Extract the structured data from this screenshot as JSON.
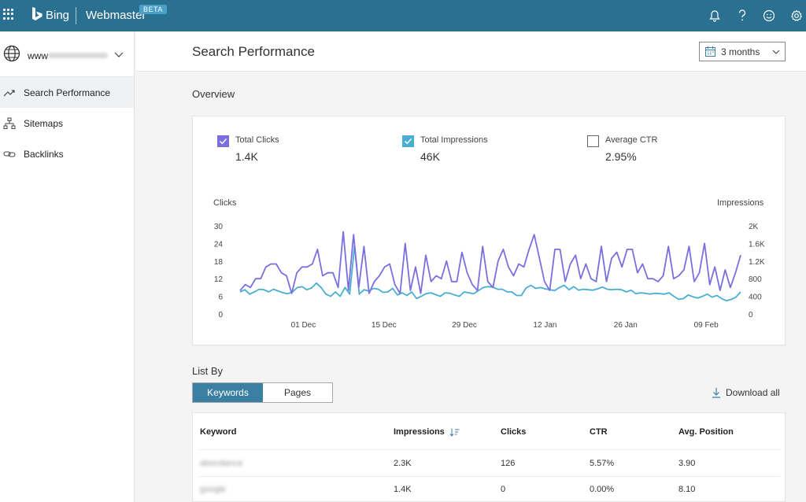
{
  "topbar": {
    "brand": "Bing",
    "product": "Webmaster",
    "badge": "BETA",
    "icons": [
      "apps-grid-icon",
      "bing-logo-icon",
      "bell-icon",
      "help-icon",
      "smiley-feedback-icon",
      "gear-icon"
    ]
  },
  "sidebar": {
    "site_prefix": "www",
    "items": [
      {
        "label": "Search Performance",
        "icon": "trend-line-icon",
        "active": true
      },
      {
        "label": "Sitemaps",
        "icon": "sitemap-icon",
        "active": false
      },
      {
        "label": "Backlinks",
        "icon": "link-icon",
        "active": false
      }
    ]
  },
  "header": {
    "title": "Search Performance",
    "range": "3 months"
  },
  "overview": {
    "label": "Overview",
    "metrics": [
      {
        "label": "Total Clicks",
        "value": "1.4K",
        "checked": true,
        "color": "#7b6fe0"
      },
      {
        "label": "Total Impressions",
        "value": "46K",
        "checked": true,
        "color": "#4aaed2"
      },
      {
        "label": "Average CTR",
        "value": "2.95%",
        "checked": false
      }
    ]
  },
  "chart_data": {
    "type": "line",
    "ylabel_left": "Clicks",
    "ylabel_right": "Impressions",
    "ylim_left": [
      0,
      30
    ],
    "ylim_right": [
      0,
      2000
    ],
    "left_ticks": [
      "0",
      "6",
      "12",
      "18",
      "24",
      "30"
    ],
    "right_ticks": [
      "0",
      "400",
      "800",
      "1.2K",
      "1.6K",
      "2K"
    ],
    "x_ticks": [
      "01 Dec",
      "15 Dec",
      "29 Dec",
      "12 Jan",
      "26 Jan",
      "09 Feb"
    ],
    "grid": false,
    "series": [
      {
        "name": "Total Clicks",
        "axis": "left",
        "color": "#7b6fe0",
        "values": [
          8,
          10,
          9,
          12,
          12,
          16,
          17,
          17,
          14,
          13,
          7,
          14,
          16,
          16,
          17,
          22,
          13,
          14,
          14,
          9,
          28,
          8,
          27,
          9,
          23,
          7,
          11,
          13,
          16,
          17,
          10,
          7,
          24,
          8,
          16,
          7,
          20,
          11,
          13,
          12,
          18,
          11,
          11,
          21,
          14,
          10,
          8,
          23,
          11,
          9,
          18,
          22,
          16,
          13,
          17,
          16,
          22,
          27,
          19,
          11,
          8,
          22,
          22,
          11,
          17,
          20,
          12,
          17,
          12,
          11,
          23,
          11,
          19,
          21,
          16,
          22,
          22,
          14,
          17,
          12,
          12,
          11,
          13,
          23,
          12,
          13,
          15,
          23,
          11,
          14,
          24,
          10,
          16,
          8,
          15,
          9,
          14,
          20
        ],
        "start": "2024-11-20",
        "end": "2025-02-15"
      },
      {
        "name": "Total Impressions",
        "axis": "right",
        "color": "#4aaed2",
        "values": [
          500,
          550,
          450,
          500,
          560,
          550,
          500,
          560,
          520,
          480,
          460,
          500,
          600,
          620,
          550,
          590,
          700,
          600,
          450,
          400,
          500,
          400,
          600,
          450,
          1550,
          450,
          550,
          520,
          580,
          560,
          490,
          500,
          580,
          430,
          480,
          420,
          500,
          350,
          400,
          460,
          480,
          440,
          400,
          480,
          470,
          430,
          400,
          500,
          480,
          460,
          530,
          600,
          620,
          610,
          560,
          560,
          500,
          500,
          420,
          420,
          590,
          650,
          580,
          600,
          570,
          550,
          530,
          600,
          650,
          550,
          620,
          540,
          560,
          550,
          540,
          570,
          610,
          560,
          550,
          560,
          550,
          500,
          540,
          460,
          480,
          470,
          450,
          470,
          460,
          450,
          480,
          400,
          330,
          350,
          430,
          390,
          360,
          400,
          450,
          380,
          420,
          350,
          300,
          330,
          380,
          500
        ],
        "start": "2024-11-20",
        "end": "2025-02-15"
      }
    ]
  },
  "list_by": {
    "label": "List By",
    "tabs": [
      {
        "label": "Keywords",
        "active": true
      },
      {
        "label": "Pages",
        "active": false
      }
    ],
    "download_label": "Download all"
  },
  "table": {
    "columns": [
      "Keyword",
      "Impressions",
      "Clicks",
      "CTR",
      "Avg. Position"
    ],
    "rows": [
      {
        "keyword": "abondance",
        "impressions": "2.3K",
        "clicks": "126",
        "ctr": "5.57%",
        "position": "3.90"
      },
      {
        "keyword": "google",
        "impressions": "1.4K",
        "clicks": "0",
        "ctr": "0.00%",
        "position": "8.10"
      }
    ]
  }
}
